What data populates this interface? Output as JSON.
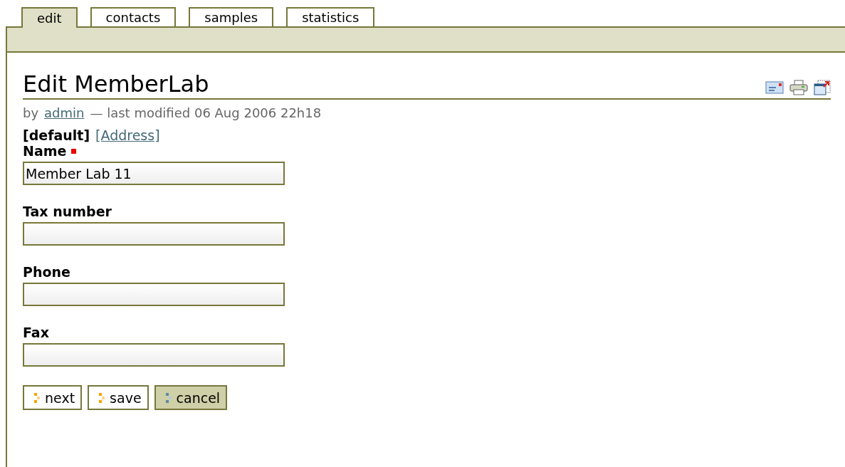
{
  "tabs": [
    {
      "label": "edit",
      "selected": true
    },
    {
      "label": "contacts",
      "selected": false
    },
    {
      "label": "samples",
      "selected": false
    },
    {
      "label": "statistics",
      "selected": false
    }
  ],
  "title": "Edit MemberLab",
  "byline": {
    "prefix": "by",
    "author": "admin",
    "suffix": "— last modified 06 Aug 2006 22h18"
  },
  "fieldsets": [
    {
      "label": "[default]",
      "selected": true
    },
    {
      "label": "[Address]",
      "selected": false
    }
  ],
  "fields": [
    {
      "label": "Name",
      "required": true,
      "value": "Member Lab 11"
    },
    {
      "label": "Tax number",
      "required": false
    },
    {
      "label": "Phone",
      "required": false
    },
    {
      "label": "Fax",
      "required": false
    }
  ],
  "buttons": [
    {
      "label": "next",
      "kind": "submit"
    },
    {
      "label": "save",
      "kind": "submit"
    },
    {
      "label": "cancel",
      "kind": "cancel"
    }
  ]
}
